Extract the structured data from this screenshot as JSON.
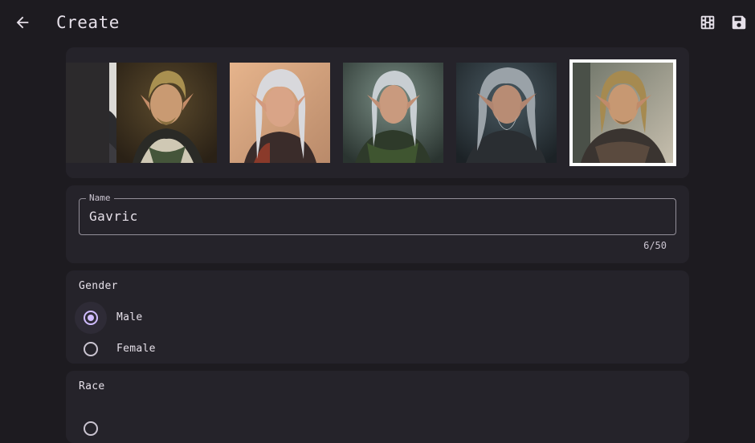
{
  "header": {
    "back_icon": "arrow-left-icon",
    "title": "Create",
    "gallery_icon": "film-grid-icon",
    "save_icon": "save-disk-icon"
  },
  "portraits": {
    "items": [
      {
        "description": "elf portrait partial",
        "selected": false
      },
      {
        "description": "blond elf with green scarf",
        "selected": false
      },
      {
        "description": "silver-haired elf",
        "selected": false
      },
      {
        "description": "white-haired elf in green cloak",
        "selected": false
      },
      {
        "description": "grey-haired bearded elf",
        "selected": false
      },
      {
        "description": "blond elf in leather armor",
        "selected": true
      }
    ]
  },
  "name_field": {
    "label": "Name",
    "value": "Gavric",
    "counter": "6/50"
  },
  "gender": {
    "label": "Gender",
    "options": [
      {
        "label": "Male",
        "checked": true
      },
      {
        "label": "Female",
        "checked": false
      }
    ]
  },
  "race": {
    "label": "Race"
  },
  "colors": {
    "background": "#1d1b20",
    "card": "#25232a",
    "accent": "#d0bcff",
    "outline": "#938f99"
  }
}
